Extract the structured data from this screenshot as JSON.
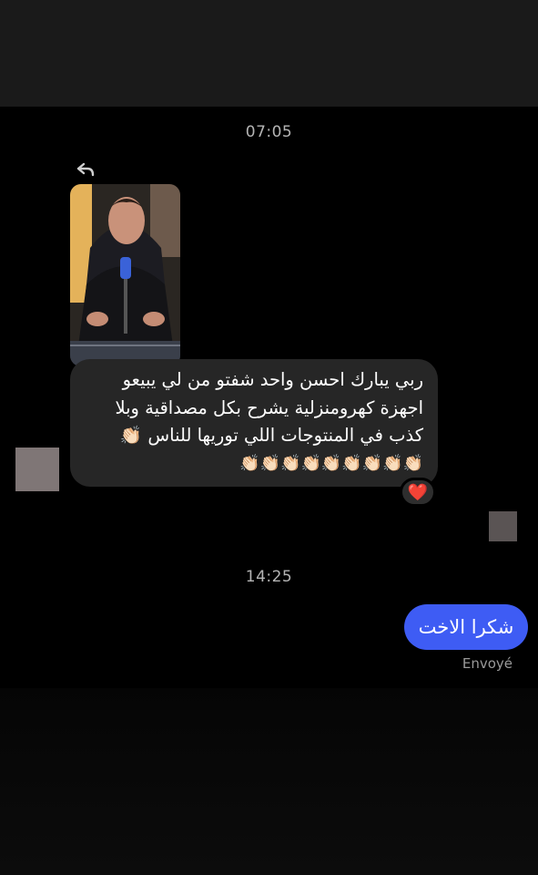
{
  "conversation": {
    "timestamp_1": "07:05",
    "timestamp_2": "14:25",
    "incoming_message": {
      "lines": [
        "ربي يبارك احسن واحد شفتو من لي يبيعو",
        "اجهزة كهرومنزلية يشرح بكل مصداقية وبلا",
        "كذب في المنتوجات اللي توريها للناس 👏🏻",
        "👏🏻👏🏻👏🏻👏🏻👏🏻👏🏻👏🏻👏🏻👏🏻"
      ],
      "reaction": "❤️"
    },
    "outgoing_message": {
      "text": "شكرا الاخت",
      "status": "Envoyé"
    }
  },
  "colors": {
    "outgoing_bubble": "#3e5cf4",
    "incoming_bubble": "#262626",
    "reaction_heart": "#ff2d3d"
  },
  "icons": {
    "reply": "reply-arrow-icon",
    "reaction": "heart-icon"
  }
}
